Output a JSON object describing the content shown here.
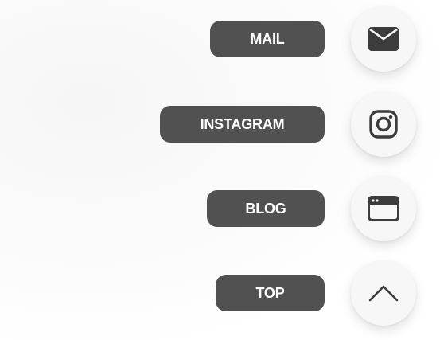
{
  "fab_menu": {
    "items": [
      {
        "label": "MAIL",
        "icon": "mail-icon"
      },
      {
        "label": "INSTAGRAM",
        "icon": "instagram-icon"
      },
      {
        "label": "BLOG",
        "icon": "browser-window-icon"
      },
      {
        "label": "TOP",
        "icon": "chevron-up-icon"
      }
    ]
  },
  "colors": {
    "label_bg": "#515151",
    "label_text": "#ffffff",
    "icon": "#3c3c3c",
    "circle_bg": "#f7f7f8"
  }
}
